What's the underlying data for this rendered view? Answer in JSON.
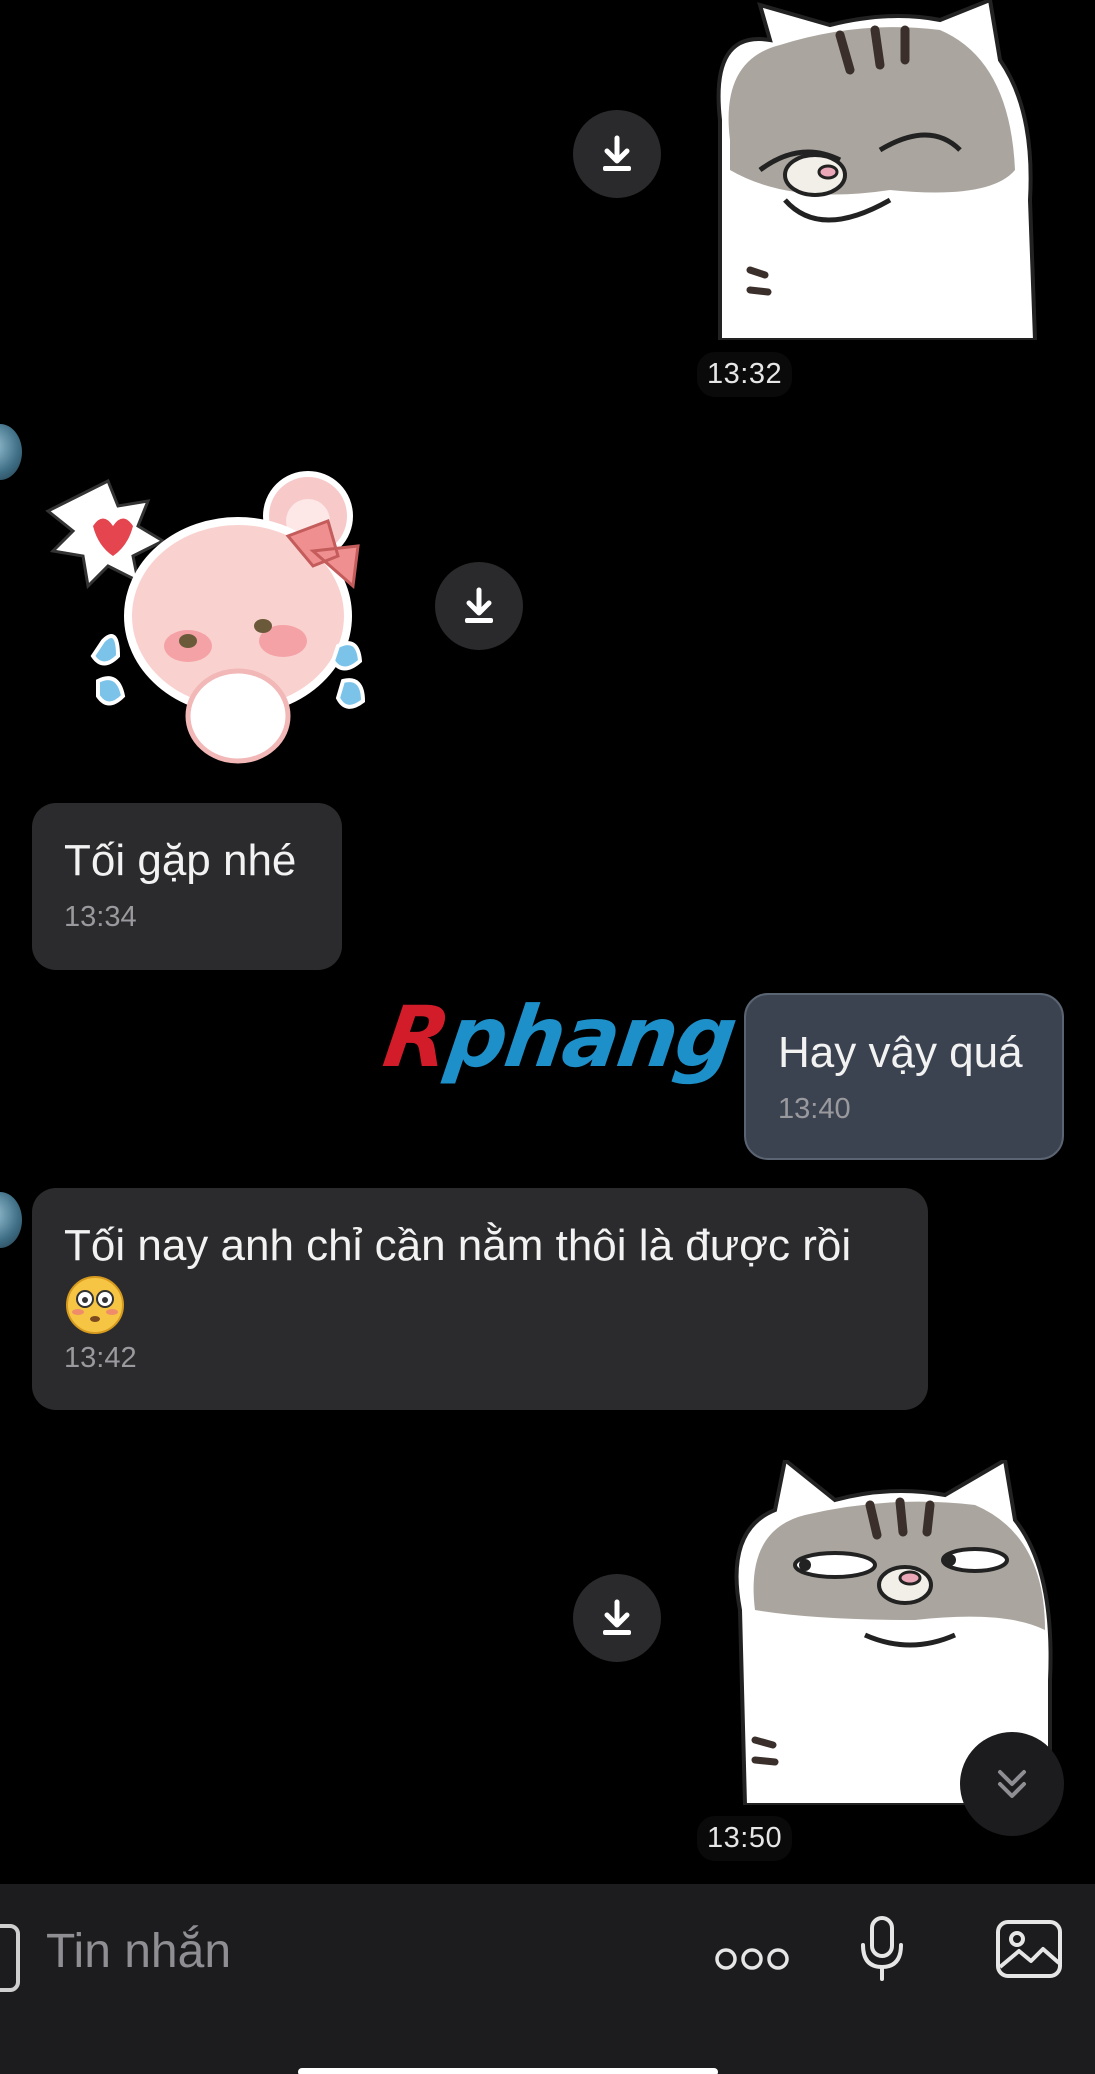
{
  "messages": [
    {
      "type": "sticker",
      "direction": "outgoing",
      "sticker": "grey-cat-smirk-sticker",
      "time": "13:32"
    },
    {
      "type": "sticker",
      "direction": "incoming",
      "sticker": "pink-bear-crying-sticker"
    },
    {
      "type": "text",
      "direction": "incoming",
      "text": "Tối gặp nhé",
      "time": "13:34"
    },
    {
      "type": "text",
      "direction": "outgoing",
      "text": "Hay vậy quá",
      "time": "13:40"
    },
    {
      "type": "text",
      "direction": "incoming",
      "text": "Tối nay anh chỉ cần nằm thôi là được rồi",
      "emoji": "😳",
      "time": "13:42"
    },
    {
      "type": "sticker",
      "direction": "outgoing",
      "sticker": "grey-cat-side-eye-sticker",
      "time": "13:50"
    }
  ],
  "watermark": {
    "first": "R",
    "rest": "phang"
  },
  "composer": {
    "placeholder": "Tin nhắn",
    "icons": [
      "attach-icon",
      "more-icon",
      "microphone-icon",
      "image-icon"
    ]
  },
  "controls": {
    "scroll_down_icon": "double-chevron-down-icon",
    "download_icon": "download-icon"
  },
  "colors": {
    "background": "#000000",
    "incoming_bubble": "#2b2b2d",
    "outgoing_bubble": "#3c4350",
    "watermark_red": "#d21c2a",
    "watermark_blue": "#1d8fc9"
  }
}
